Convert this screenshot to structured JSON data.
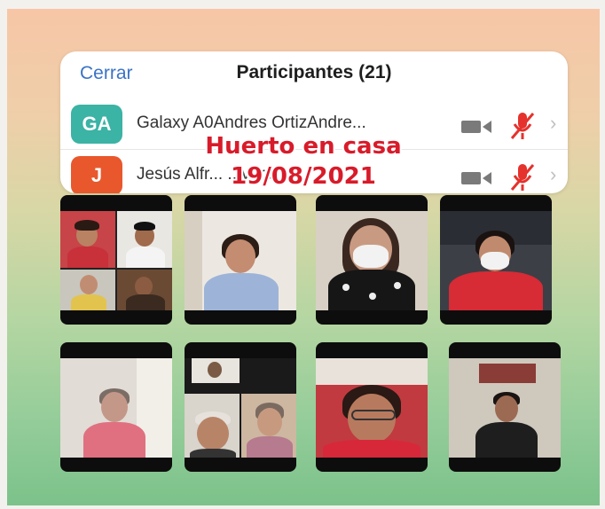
{
  "participants_panel": {
    "close_label": "Cerrar",
    "title": "Participantes (21)",
    "rows": [
      {
        "avatar_initials": "GA",
        "avatar_color": "#3bb3a5",
        "name": "Galaxy A0Andres OrtizAndre...",
        "camera_icon": "video-camera-icon",
        "mic_icon": "muted-mic-icon",
        "chevron_icon": "chevron-right-icon"
      },
      {
        "avatar_initials": "J",
        "avatar_color": "#e8582c",
        "name": "Jesús Alfr...           ...vara",
        "camera_icon": "video-camera-icon",
        "mic_icon": "muted-mic-icon",
        "chevron_icon": "chevron-right-icon"
      }
    ]
  },
  "overlay_caption": {
    "line1": "Huerto en casa",
    "line2": "19/08/2021",
    "color": "#d81b2a"
  },
  "video_tiles_count": 8,
  "colors": {
    "accent_blue": "#3b73c6",
    "mute_red": "#e5322d",
    "tile_bg": "#0d0d0d"
  }
}
